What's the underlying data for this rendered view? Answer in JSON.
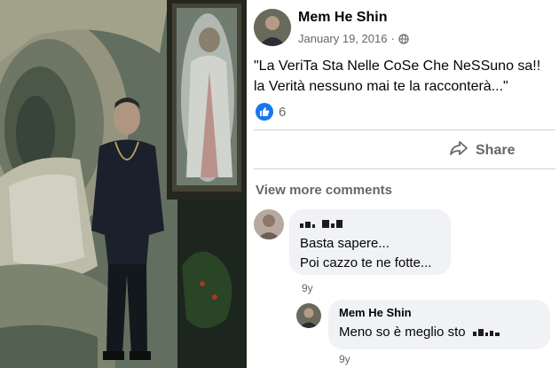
{
  "post": {
    "author": "Mem He Shin",
    "date": "January 19, 2016",
    "privacy_dot": "·",
    "text_line1": "\"La VeriTa Sta Nelle CoSe Che NeSSuno sa!!",
    "text_line2": "la Verità nessuno mai te la racconterà...\"",
    "reaction_count": "6",
    "share_label": "Share"
  },
  "comments": {
    "view_more_label": "View more comments",
    "items": [
      {
        "line1": "Basta sapere...",
        "line2": "Poi cazzo te ne fotte...",
        "time": "9y"
      },
      {
        "author": "Mem He Shin",
        "text": "Meno so è meglio sto",
        "time": "9y"
      }
    ]
  },
  "colors": {
    "accent": "#1877f2",
    "bubble": "#f0f2f5",
    "secondary_text": "#65676b"
  },
  "icons": {
    "privacy": "globe-icon",
    "reaction": "like-icon",
    "share": "share-arrow-icon"
  }
}
